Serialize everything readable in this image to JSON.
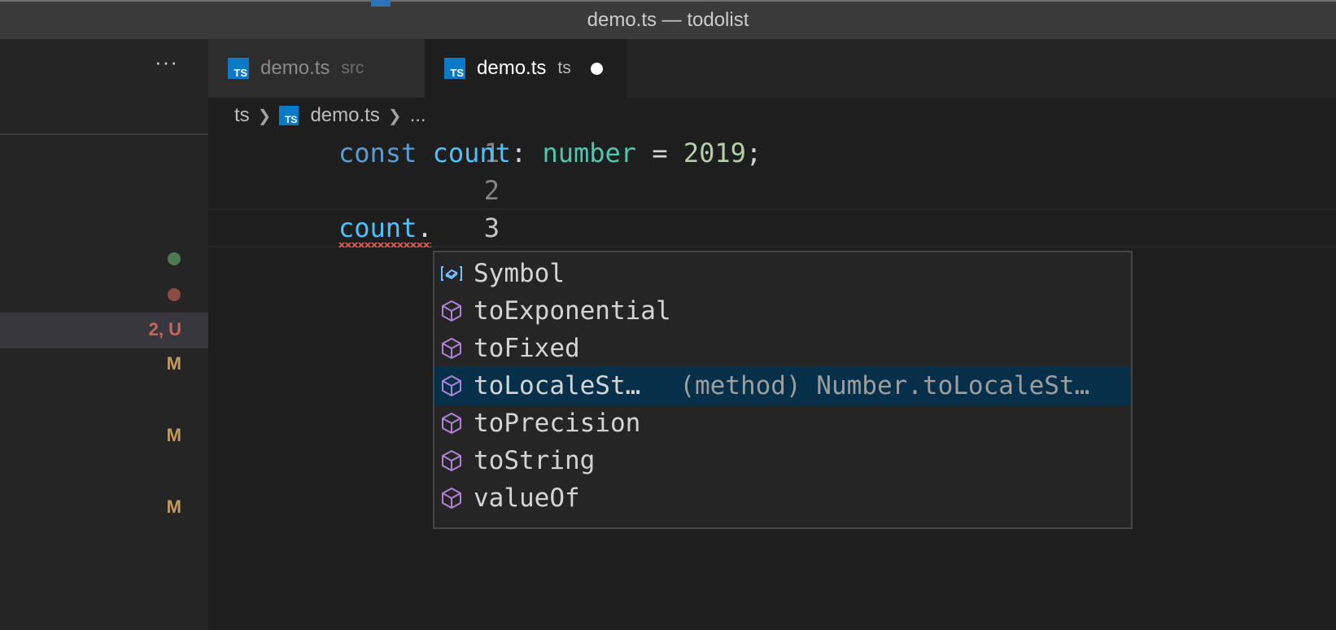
{
  "window": {
    "title": "demo.ts — todolist"
  },
  "sidebar": {
    "more_label": "···",
    "statuses": [
      "2, U",
      "M",
      "M",
      "M"
    ]
  },
  "tabs": [
    {
      "label": "demo.ts",
      "description": "src",
      "active": false
    },
    {
      "label": "demo.ts",
      "description": "ts",
      "active": true,
      "dirty": true
    }
  ],
  "breadcrumbs": {
    "folder": "ts",
    "file": "demo.ts",
    "symbol": "..."
  },
  "editor": {
    "lines": [
      {
        "number": "1",
        "tokens": [
          "const",
          " ",
          "count",
          ": ",
          "number",
          " = ",
          "2019",
          ";"
        ]
      },
      {
        "number": "2",
        "tokens": []
      },
      {
        "number": "3",
        "tokens": [
          "count",
          "."
        ]
      }
    ]
  },
  "suggestions": {
    "items": [
      {
        "label": "Symbol",
        "icon": "property-icon"
      },
      {
        "label": "toExponential",
        "icon": "method-icon"
      },
      {
        "label": "toFixed",
        "icon": "method-icon"
      },
      {
        "label": "toLocaleSt…",
        "icon": "method-icon",
        "detail": "(method) Number.toLocaleSt…",
        "selected": true
      },
      {
        "label": "toPrecision",
        "icon": "method-icon"
      },
      {
        "label": "toString",
        "icon": "method-icon"
      },
      {
        "label": "valueOf",
        "icon": "method-icon"
      }
    ]
  },
  "colors": {
    "keyword": "#569cd6",
    "variable": "#4fc1ff",
    "type": "#4ec9b0",
    "number": "#b5cea8",
    "selection": "#062f4a",
    "ts_icon": "#0b79c5",
    "method_icon": "#b180d7"
  }
}
